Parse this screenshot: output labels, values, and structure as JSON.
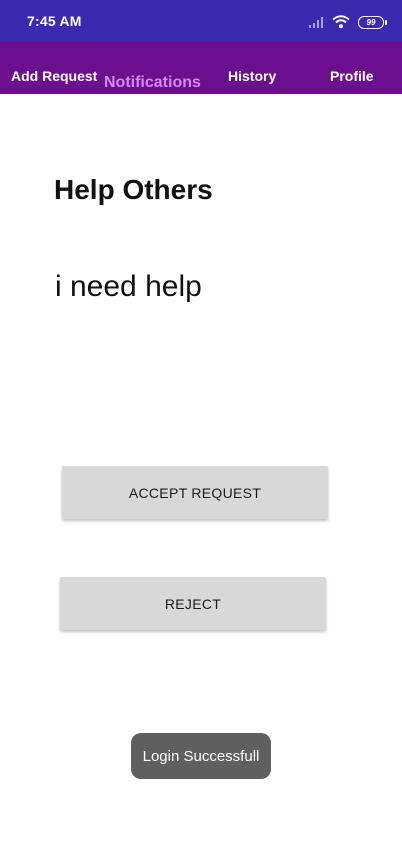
{
  "status": {
    "time": "7:45 AM",
    "battery": "99",
    "icons": [
      "signal-icon",
      "wifi-icon",
      "battery-icon"
    ]
  },
  "nav": {
    "items": [
      {
        "label": "Add Request",
        "active": false
      },
      {
        "label": "Notifications",
        "active": true
      },
      {
        "label": "History",
        "active": false
      },
      {
        "label": "Profile",
        "active": false
      }
    ]
  },
  "content": {
    "title": "Help Others",
    "request_message": "i need help"
  },
  "actions": {
    "accept_label": "ACCEPT REQUEST",
    "reject_label": "REJECT"
  },
  "toast": {
    "message": "Login Successfull"
  },
  "colors": {
    "status_bar": "#3b2ab0",
    "nav_bar": "#6c0f8f",
    "active_tab": "#d58af3",
    "button_bg": "#d8d8d8",
    "toast_bg": "#5f5f5f"
  }
}
